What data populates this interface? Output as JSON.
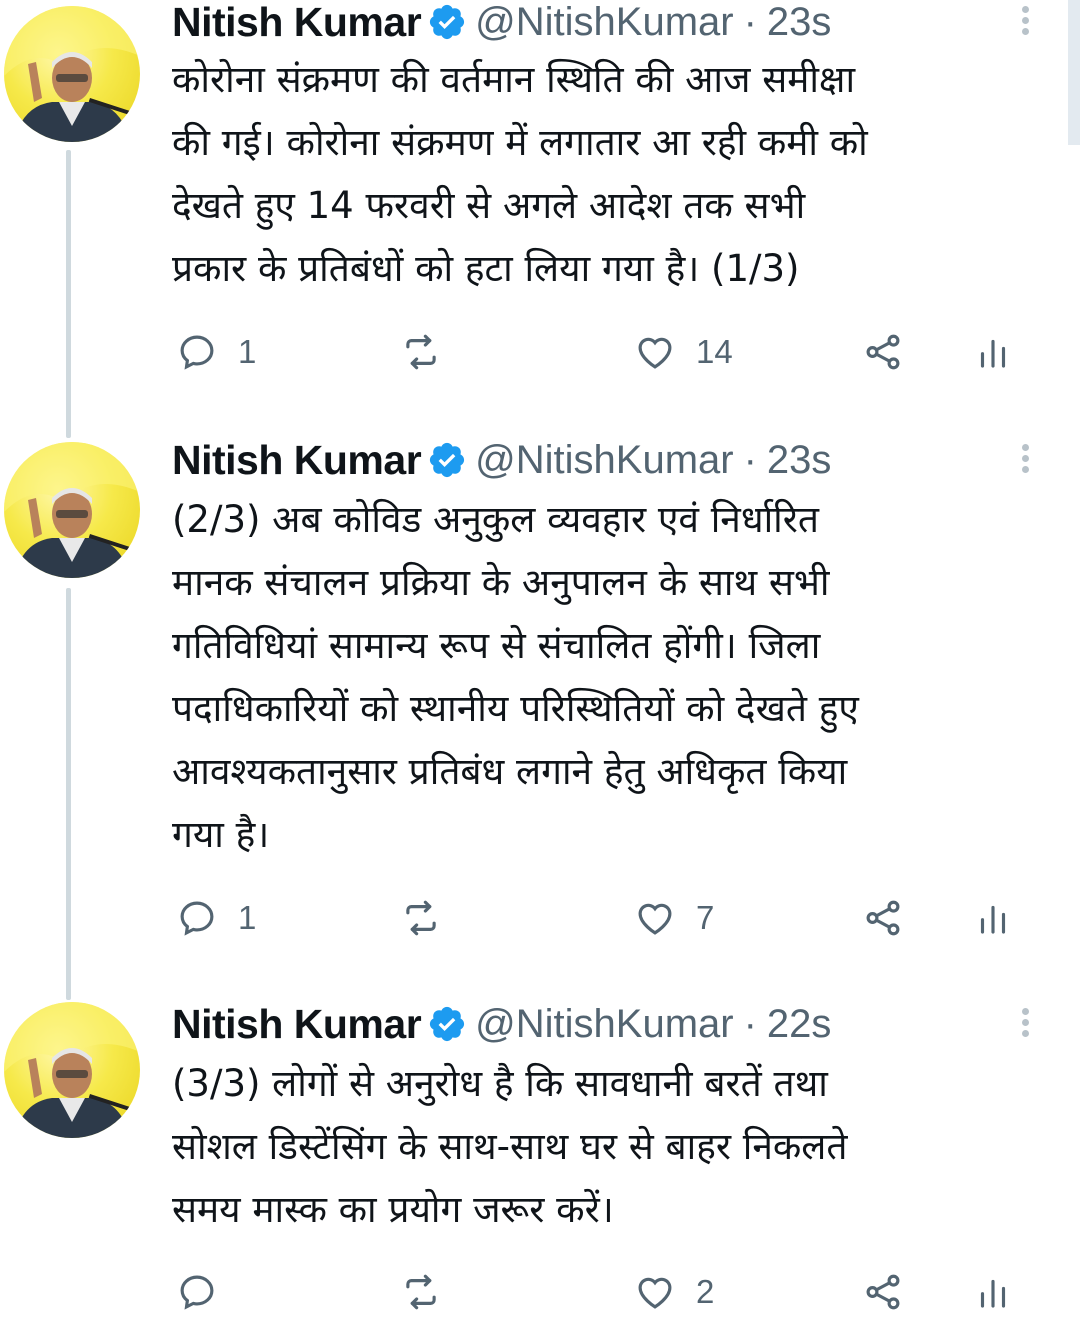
{
  "tweets": [
    {
      "name": "Nitish Kumar",
      "handle": "@NitishKumar",
      "time": "23s",
      "lines": [
        "कोरोना संक्रमण की वर्तमान स्थिति की आज समीक्षा",
        "की गई। कोरोना संक्रमण में लगातार आ रही कमी को",
        "देखते हुए 14 फरवरी से अगले आदेश तक सभी",
        "प्रकार के प्रतिबंधों को हटा लिया गया है। (1/3)"
      ],
      "replies": "1",
      "retweets": "",
      "likes": "14"
    },
    {
      "name": "Nitish Kumar",
      "handle": "@NitishKumar",
      "time": "23s",
      "lines": [
        "(2/3) अब कोविड अनुकुल व्यवहार एवं निर्धारित",
        "मानक संचालन प्रक्रिया के अनुपालन के साथ सभी",
        "गतिविधियां सामान्य रूप से संचालित होंगी। जिला",
        "पदाधिकारियों को स्थानीय परिस्थितियों को देखते हुए",
        "आवश्यकतानुसार प्रतिबंध लगाने हेतु अधिकृत किया",
        "गया है।"
      ],
      "replies": "1",
      "retweets": "",
      "likes": "7"
    },
    {
      "name": "Nitish Kumar",
      "handle": "@NitishKumar",
      "time": "22s",
      "lines": [
        "(3/3) लोगों से अनुरोध है कि सावधानी बरतें तथा",
        "सोशल डिस्टेंसिंग के साथ-साथ घर से बाहर निकलते",
        "समय मास्क का प्रयोग जरूर करें।"
      ],
      "replies": "",
      "retweets": "",
      "likes": "2"
    }
  ],
  "icons": {
    "verified": "verified-badge-icon",
    "more": "more-vertical-icon",
    "reply": "reply-icon",
    "retweet": "retweet-icon",
    "like": "heart-icon",
    "share": "share-icon",
    "analytics": "analytics-icon"
  },
  "colors": {
    "verified": "#1d9bf0",
    "text": "#0f1419",
    "muted": "#536471",
    "thread_line": "#cfd9de",
    "avatar_bg": "#f6e94a"
  }
}
